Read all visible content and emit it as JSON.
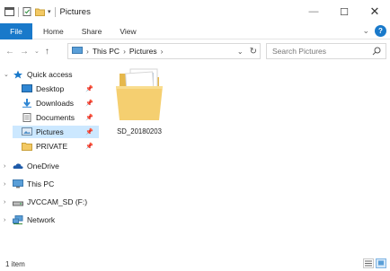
{
  "window": {
    "title": "Pictures",
    "minimize": "—",
    "maximize": "☐",
    "close": "✕"
  },
  "ribbon": {
    "tabs": [
      "File",
      "Home",
      "Share",
      "View"
    ],
    "expand": "⌄",
    "help": "?"
  },
  "address": {
    "crumbs": [
      "This PC",
      "Pictures"
    ],
    "search_placeholder": "Search Pictures"
  },
  "nav": {
    "quick_access": "Quick access",
    "quick_items": [
      {
        "label": "Desktop",
        "icon": "desktop-icon"
      },
      {
        "label": "Downloads",
        "icon": "downloads-icon"
      },
      {
        "label": "Documents",
        "icon": "documents-icon"
      },
      {
        "label": "Pictures",
        "icon": "pictures-icon"
      },
      {
        "label": "PRIVATE",
        "icon": "folder-icon"
      }
    ],
    "onedrive": "OneDrive",
    "this_pc": "This PC",
    "drive": "JVCCAM_SD (F:)",
    "network": "Network"
  },
  "content": {
    "folder_name": "SD_20180203"
  },
  "status": {
    "count": "1 item"
  },
  "colors": {
    "accent": "#1979ca",
    "selection": "#cce8ff",
    "folder": "#f3c964"
  }
}
